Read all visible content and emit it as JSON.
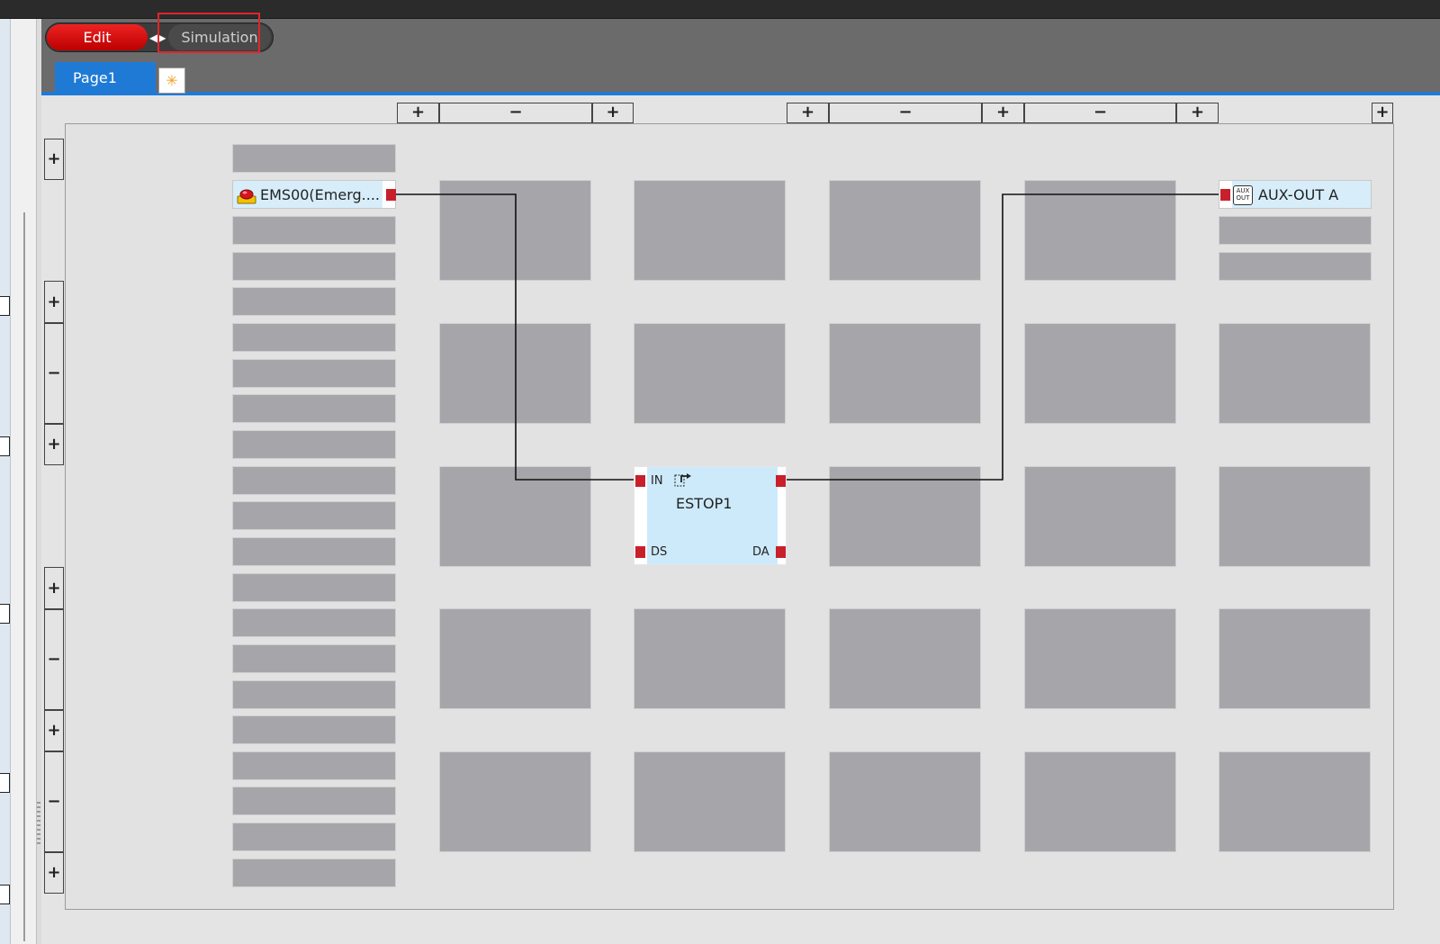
{
  "mode_switch": {
    "edit_label": "Edit",
    "simulation_label": "Simulation"
  },
  "tabs": [
    {
      "label": "Page1"
    }
  ],
  "add_tab_icon": "add-page-icon",
  "controls": {
    "plus": "+",
    "minus": "−"
  },
  "input_item": {
    "label": "EMS00(Emerg....",
    "icon": "emergency-stop-icon"
  },
  "function_block": {
    "name": "ESTOP1",
    "icon": "estop-function-icon",
    "ports": {
      "in": "IN",
      "ds": "DS",
      "da": "DA"
    }
  },
  "output_item": {
    "label": "AUX-OUT A",
    "icon": "aux-out-icon",
    "icon_text_top": "AUX",
    "icon_text_bottom": "OUT"
  },
  "colors": {
    "accent_blue": "#1f7ad6",
    "edit_red": "#dd1111",
    "port_red": "#c8202a",
    "highlight_red": "#e0262b"
  }
}
